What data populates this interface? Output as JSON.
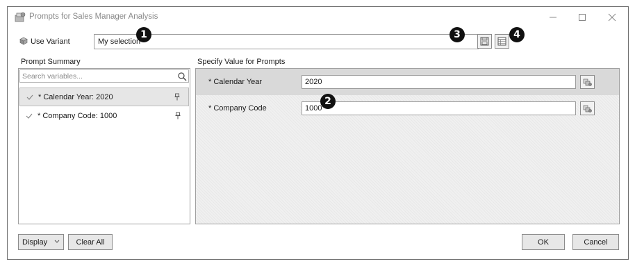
{
  "window": {
    "title": "Prompts for Sales Manager Analysis",
    "controls": [
      "minimize",
      "maximize",
      "close"
    ]
  },
  "variant": {
    "label": "Use Variant",
    "value": "My selection",
    "icons": [
      "variant-cube-icon",
      "save-icon",
      "table-icon"
    ]
  },
  "callouts": [
    "1",
    "2",
    "3",
    "4"
  ],
  "prompt_summary": {
    "heading": "Prompt Summary",
    "search_placeholder": "Search variables...",
    "items": [
      {
        "label": "* Calendar Year: 2020",
        "selected": true
      },
      {
        "label": "* Company Code: 1000",
        "selected": false
      }
    ]
  },
  "specify": {
    "heading": "Specify Value for Prompts",
    "rows": [
      {
        "label": "* Calendar Year",
        "value": "2020"
      },
      {
        "label": "* Company Code",
        "value": "1000"
      }
    ]
  },
  "footer": {
    "display_label": "Display",
    "clear_label": "Clear All",
    "ok_label": "OK",
    "cancel_label": "Cancel"
  },
  "colors": {
    "selected_row": "#d9d9d9",
    "panel_background": "#f0f0f0",
    "callout": "#111111"
  }
}
